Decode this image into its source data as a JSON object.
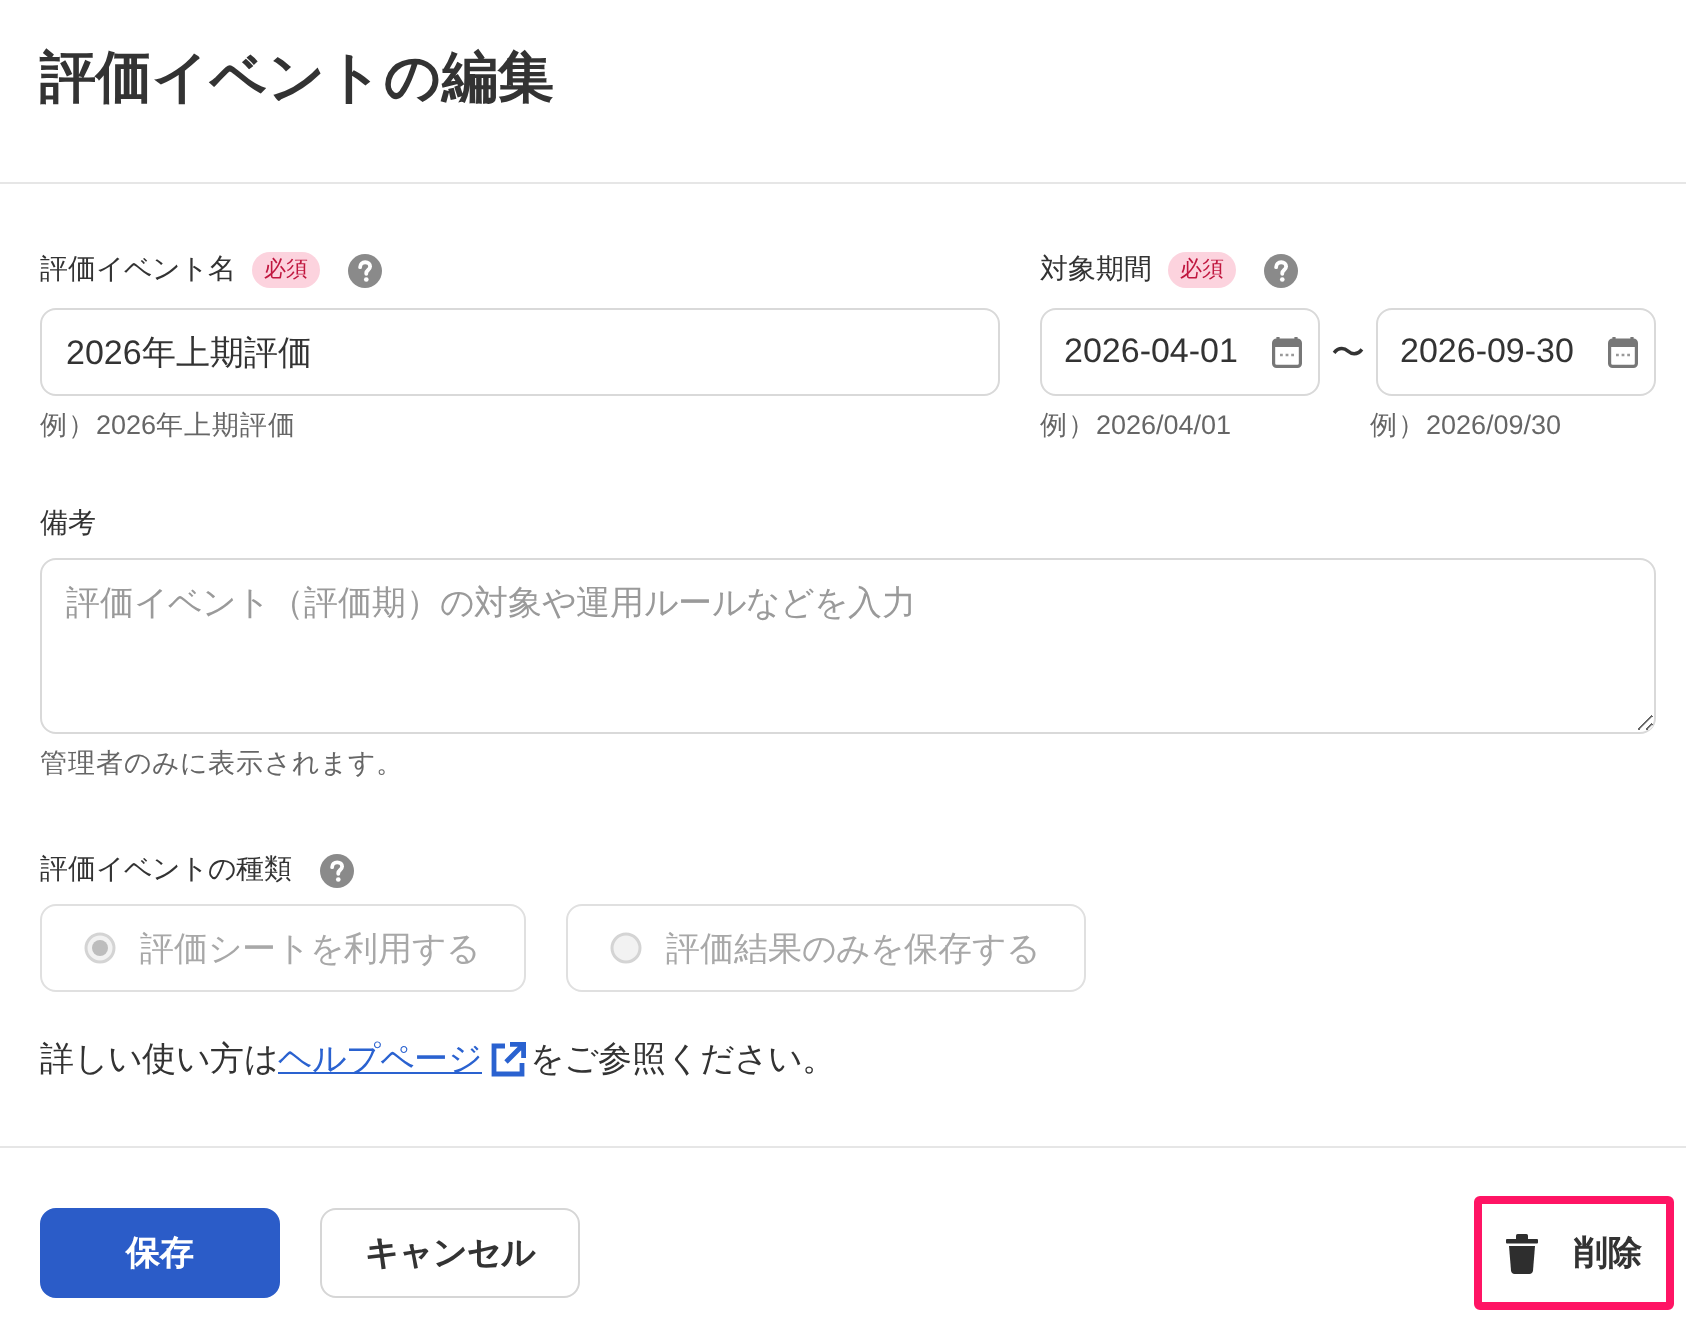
{
  "header": {
    "title": "評価イベントの編集"
  },
  "fields": {
    "event_name": {
      "label": "評価イベント名",
      "required_badge": "必須",
      "value": "2026年上期評価",
      "hint": "例）2026年上期評価"
    },
    "period": {
      "label": "対象期間",
      "required_badge": "必須",
      "start": {
        "value": "2026-04-01",
        "hint": "例）2026/04/01"
      },
      "separator": "〜",
      "end": {
        "value": "2026-09-30",
        "hint": "例）2026/09/30"
      }
    },
    "notes": {
      "label": "備考",
      "placeholder": "評価イベント（評価期）の対象や運用ルールなどを入力",
      "hint": "管理者のみに表示されます。"
    },
    "event_type": {
      "label": "評価イベントの種類",
      "disabled": true,
      "options": [
        {
          "label": "評価シートを利用する",
          "selected": true
        },
        {
          "label": "評価結果のみを保存する",
          "selected": false
        }
      ]
    }
  },
  "help_text": {
    "before": "詳しい使い方は",
    "link": "ヘルプページ",
    "after": "をご参照ください。"
  },
  "footer": {
    "buttons": [
      {
        "kind": "primary",
        "label": "保存",
        "focused": false
      },
      {
        "kind": "secondary",
        "label": "キャンセル",
        "focused": false
      },
      {
        "kind": "danger",
        "label": "削除",
        "focused": true
      }
    ]
  }
}
